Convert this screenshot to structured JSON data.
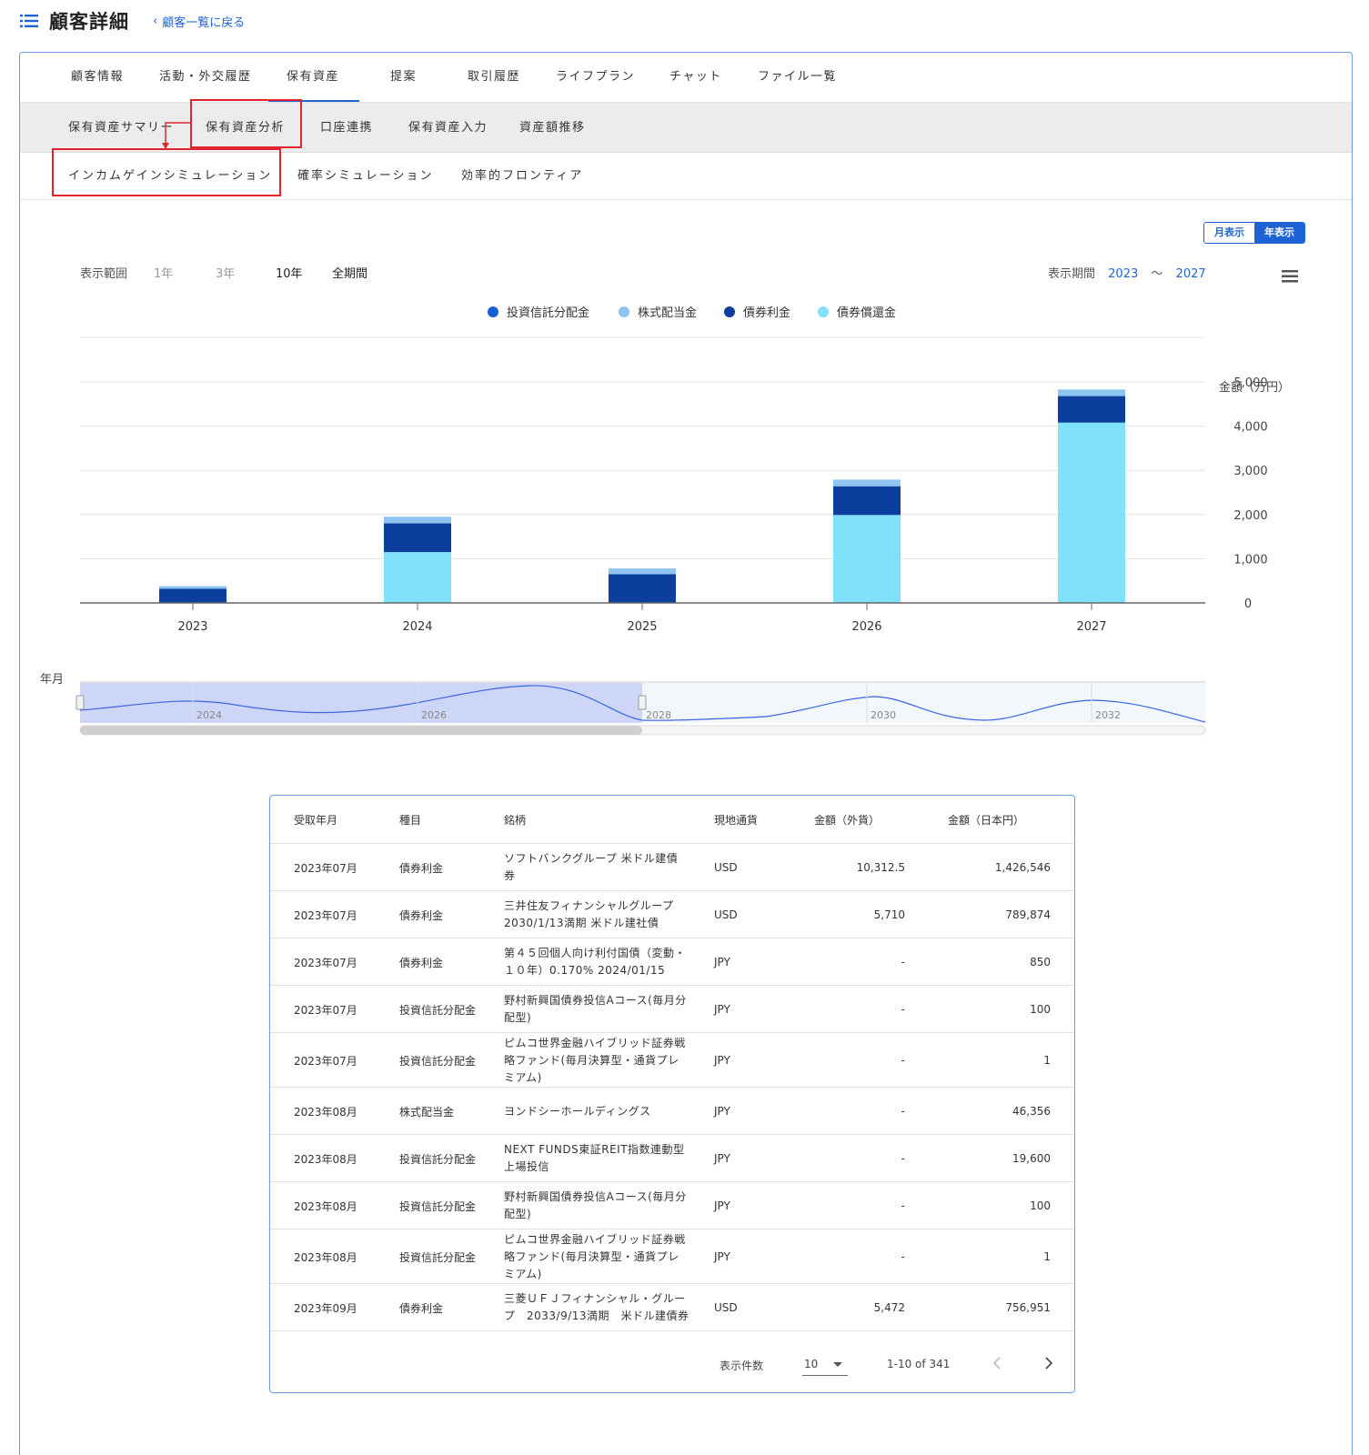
{
  "header": {
    "title": "顧客詳細",
    "back_label": "顧客一覧に戻る"
  },
  "tabs_main": [
    "顧客情報",
    "活動・外交履歴",
    "保有資産",
    "提案",
    "取引履歴",
    "ライフプラン",
    "チャット",
    "ファイル一覧"
  ],
  "tabs_sub": [
    "保有資産サマリー",
    "保有資産分析",
    "口座連携",
    "保有資産入力",
    "資産額推移"
  ],
  "tabs_third": [
    "インカムゲインシミュレーション",
    "確率シミュレーション",
    "効率的フロンティア"
  ],
  "view_toggle": {
    "monthly": "月表示",
    "yearly": "年表示",
    "selected": "年表示"
  },
  "range": {
    "label": "表示範囲",
    "options": [
      "1年",
      "3年",
      "10年",
      "全期間"
    ]
  },
  "period": {
    "label": "表示期間",
    "from": "2023",
    "tilde": "〜",
    "to": "2027"
  },
  "colors": {
    "accent": "#1e63d6",
    "highlight": "#e0262c"
  },
  "chart_data": {
    "type": "bar",
    "stacked": true,
    "categories": [
      "2023",
      "2024",
      "2025",
      "2026",
      "2027"
    ],
    "series": [
      {
        "name": "投資信託分配金",
        "color": "#1a5ed6",
        "values": [
          0,
          0,
          0,
          0,
          0
        ]
      },
      {
        "name": "株式配当金",
        "color": "#8ec4ef",
        "values": [
          60,
          150,
          130,
          150,
          150
        ]
      },
      {
        "name": "債券利金",
        "color": "#0c3e9e",
        "values": [
          320,
          650,
          650,
          650,
          600
        ]
      },
      {
        "name": "債券償還金",
        "color": "#80e1fa",
        "values": [
          0,
          1150,
          0,
          1990,
          4080
        ]
      }
    ],
    "xlabel": "年月",
    "ylabel": "金額（万円）",
    "yticks": [
      "0",
      "1,000",
      "2,000",
      "3,000",
      "4,000",
      "5,000"
    ],
    "ylim": [
      0,
      6000
    ],
    "legend": "top-center",
    "grid": true,
    "navigator": {
      "labels": [
        "2024",
        "2026",
        "2028",
        "2030",
        "2032"
      ],
      "selected_range": [
        "2023",
        "2027"
      ]
    }
  },
  "table": {
    "headers": [
      "受取年月",
      "種目",
      "銘柄",
      "現地通貨",
      "金額（外貨）",
      "金額（日本円）"
    ],
    "rows": [
      {
        "date": "2023年07月",
        "type": "債券利金",
        "name": [
          "ソフトバンクグループ 米ドル建債",
          "券"
        ],
        "currency": "USD",
        "fx": "10,312.5",
        "jpy": "1,426,546"
      },
      {
        "date": "2023年07月",
        "type": "債券利金",
        "name": [
          "三井住友フィナンシャルグループ",
          "2030/1/13満期 米ドル建社債"
        ],
        "currency": "USD",
        "fx": "5,710",
        "jpy": "789,874"
      },
      {
        "date": "2023年07月",
        "type": "債券利金",
        "name": [
          "第４５回個人向け利付国債（変動・",
          "１０年）0.170% 2024/01/15"
        ],
        "currency": "JPY",
        "fx": "-",
        "jpy": "850"
      },
      {
        "date": "2023年07月",
        "type": "投資信託分配金",
        "name": [
          "野村新興国債券投信Aコース(毎月分",
          "配型)"
        ],
        "currency": "JPY",
        "fx": "-",
        "jpy": "100"
      },
      {
        "date": "2023年07月",
        "type": "投資信託分配金",
        "name": [
          "ピムコ世界金融ハイブリッド証券戦",
          "略ファンド(毎月決算型・通貨プレ",
          "ミアム)"
        ],
        "currency": "JPY",
        "fx": "-",
        "jpy": "1"
      },
      {
        "date": "2023年08月",
        "type": "株式配当金",
        "name": [
          "ヨンドシーホールディングス"
        ],
        "currency": "JPY",
        "fx": "-",
        "jpy": "46,356"
      },
      {
        "date": "2023年08月",
        "type": "投資信託分配金",
        "name": [
          "NEXT FUNDS東証REIT指数連動型",
          "上場投信"
        ],
        "currency": "JPY",
        "fx": "-",
        "jpy": "19,600"
      },
      {
        "date": "2023年08月",
        "type": "投資信託分配金",
        "name": [
          "野村新興国債券投信Aコース(毎月分",
          "配型)"
        ],
        "currency": "JPY",
        "fx": "-",
        "jpy": "100"
      },
      {
        "date": "2023年08月",
        "type": "投資信託分配金",
        "name": [
          "ピムコ世界金融ハイブリッド証券戦",
          "略ファンド(毎月決算型・通貨プレ",
          "ミアム)"
        ],
        "currency": "JPY",
        "fx": "-",
        "jpy": "1"
      },
      {
        "date": "2023年09月",
        "type": "債券利金",
        "name": [
          "三菱ＵＦＪフィナンシャル・グルー",
          "プ　2033/9/13満期　米ドル建債券"
        ],
        "currency": "USD",
        "fx": "5,472",
        "jpy": "756,951"
      }
    ]
  },
  "pager": {
    "label": "表示件数",
    "per_page": "10",
    "range": "1-10 of 341"
  }
}
